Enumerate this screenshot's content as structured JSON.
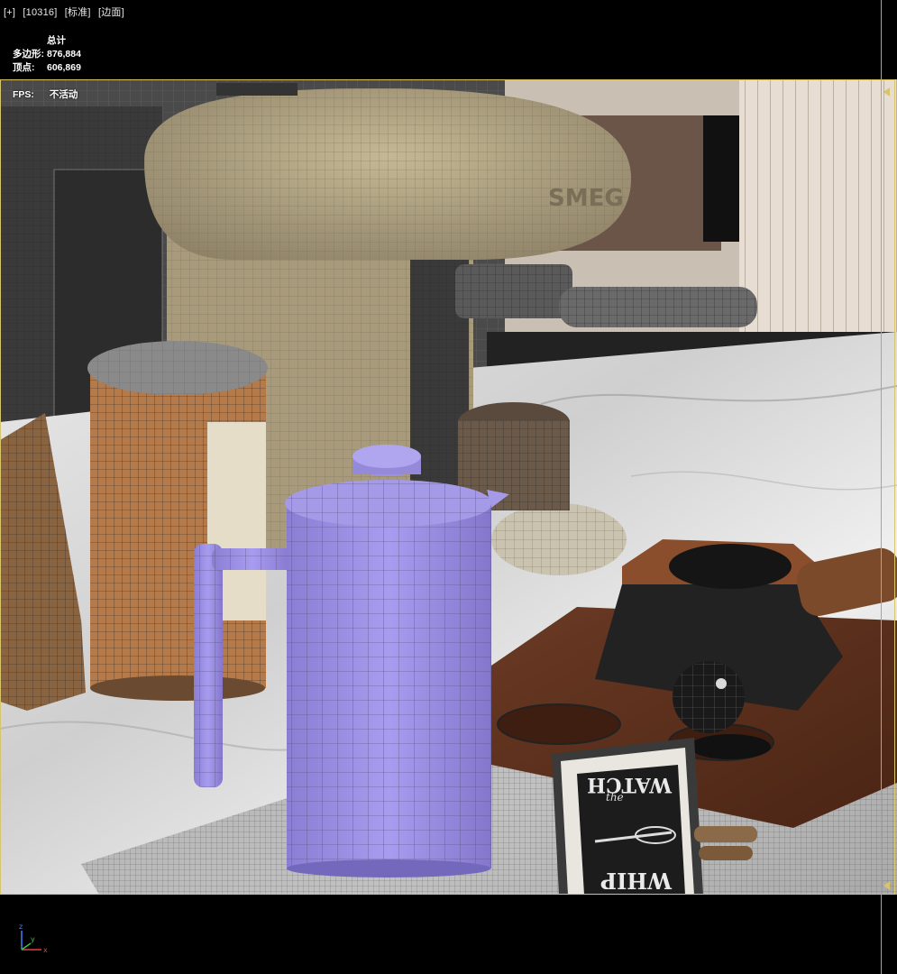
{
  "viewport": {
    "menu": [
      "[+]",
      "[10316]",
      "[标准]",
      "[边面]"
    ]
  },
  "stats": {
    "total_label": "总计",
    "polygons_label": "多边形:",
    "polygons_value": "876,884",
    "vertices_label": "顶点:",
    "vertices_value": "606,869",
    "fps_label": "FPS:",
    "fps_value": "不活动"
  },
  "scene": {
    "sign_lines": [
      "WATCH",
      "the",
      "WHIP"
    ],
    "brand": "SMEG"
  },
  "axis": {
    "x": "x",
    "y": "y",
    "z": "z"
  },
  "colors": {
    "safe_frame": "#d8c46a",
    "machine": "#b0a382",
    "normal_map": "#9a8fe0",
    "wood": "#5b2f1e"
  }
}
